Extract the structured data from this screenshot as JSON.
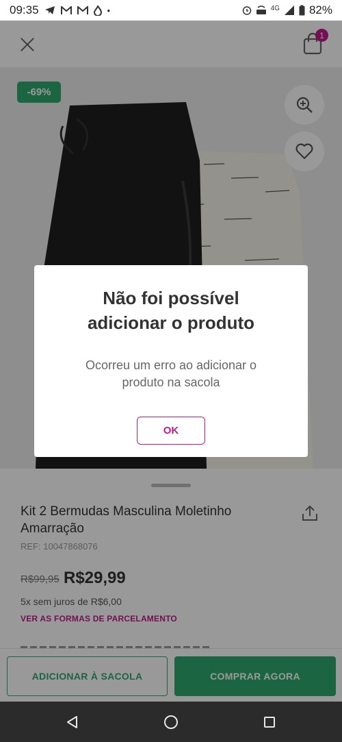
{
  "status_bar": {
    "time": "09:35",
    "battery": "82%",
    "network": "4G"
  },
  "header": {
    "cart_count": "1"
  },
  "product": {
    "discount": "-69%",
    "title": "Kit 2 Bermudas Masculina Moletinho Amarração",
    "ref": "REF: 10047868076",
    "old_price": "R$99,95",
    "price": "R$29,99",
    "installments": "5x sem juros de R$6,00",
    "installments_link": "VER AS FORMAS DE PARCELAMENTO"
  },
  "actions": {
    "add_to_bag": "ADICIONAR À SACOLA",
    "buy_now": "COMPRAR AGORA"
  },
  "dialog": {
    "title_line1": "Não foi possível",
    "title_line2": "adicionar o produto",
    "message_line1": "Ocorreu um erro ao adicionar o",
    "message_line2": "produto na sacola",
    "ok": "OK"
  },
  "colors": {
    "brand_green": "#2fa870",
    "accent_magenta": "#c21a8c"
  },
  "icons": [
    "close-icon",
    "bag-icon",
    "zoom-in-icon",
    "heart-icon",
    "share-icon",
    "nav-back-icon",
    "nav-home-icon",
    "nav-recent-icon"
  ]
}
